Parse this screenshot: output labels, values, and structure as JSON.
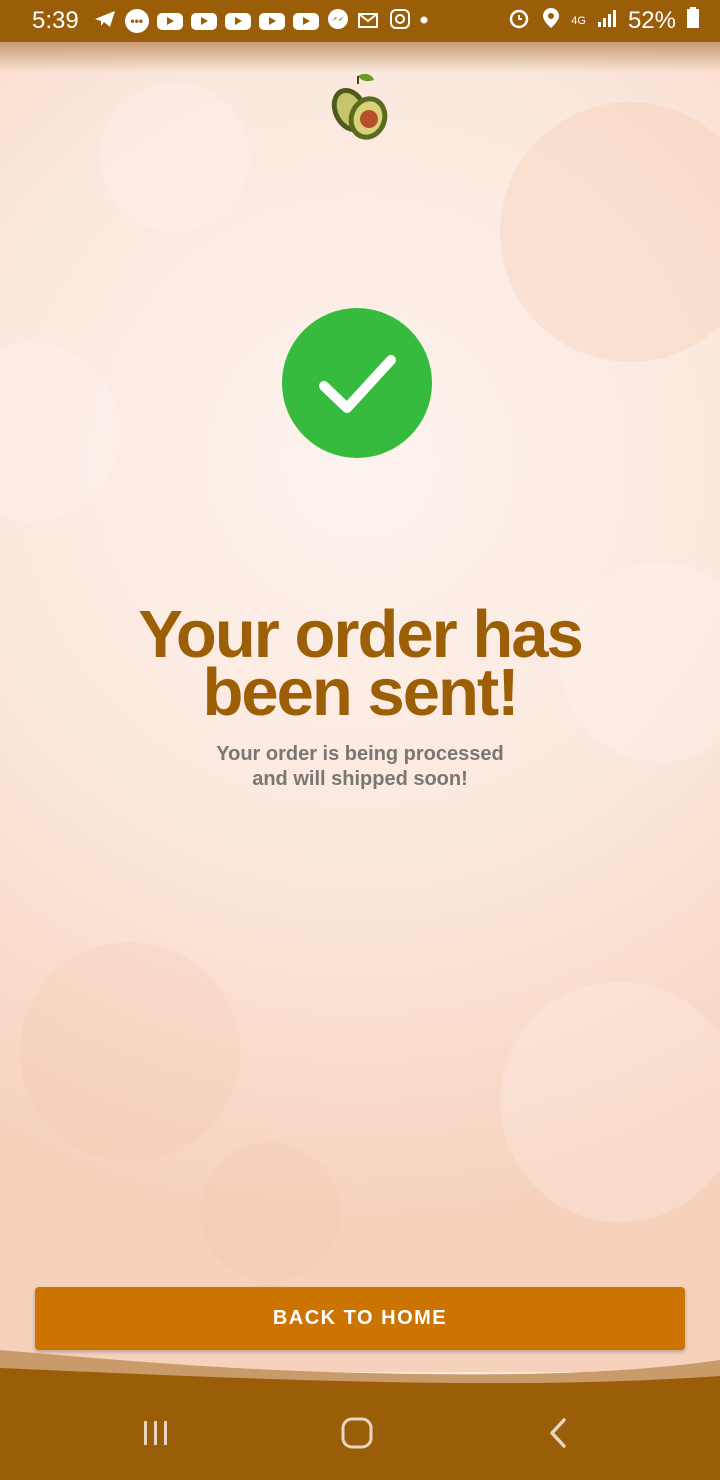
{
  "status_bar": {
    "time": "5:39",
    "battery": "52%",
    "network": "4G",
    "icons": [
      "telegram-icon",
      "messages-icon",
      "youtube-icon",
      "youtube-icon",
      "youtube-icon",
      "youtube-icon",
      "youtube-icon",
      "messenger-icon",
      "mail-icon",
      "instagram-icon",
      "dot-icon",
      "alarm-icon",
      "location-icon",
      "signal-icon",
      "battery-icon"
    ]
  },
  "brand": {
    "logo": "avocado-logo"
  },
  "success": {
    "icon": "check-circle-icon",
    "title_line1": "Your order has",
    "title_line2": "been sent!",
    "subtitle_line1": "Your order is being processed",
    "subtitle_line2": "and will shipped soon!"
  },
  "actions": {
    "back_home_label": "BACK TO HOME"
  },
  "nav": {
    "icons": [
      "recent-apps-icon",
      "home-icon",
      "back-icon"
    ]
  },
  "colors": {
    "accent": "#cb7402",
    "brand_brown": "#9a5d08",
    "success_green": "#36bb3f",
    "title_brown": "#9d5f05"
  }
}
